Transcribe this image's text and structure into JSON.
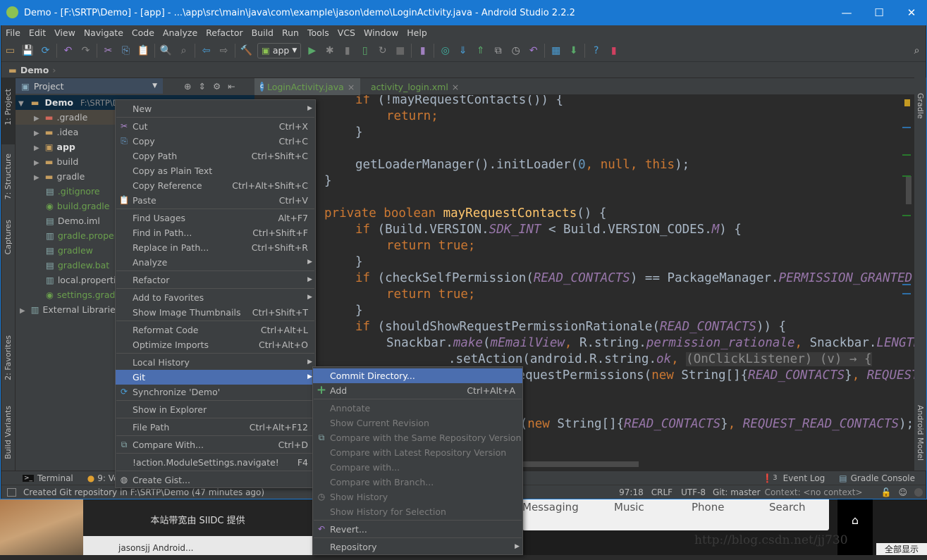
{
  "window": {
    "title": "Demo - [F:\\SRTP\\Demo] - [app] - ...\\app\\src\\main\\java\\com\\example\\jason\\demo\\LoginActivity.java - Android Studio 2.2.2",
    "controls": [
      "minimize",
      "maximize",
      "close"
    ]
  },
  "menubar": [
    "File",
    "Edit",
    "View",
    "Navigate",
    "Code",
    "Analyze",
    "Refactor",
    "Build",
    "Run",
    "Tools",
    "VCS",
    "Window",
    "Help"
  ],
  "toolbar": {
    "icons_left": [
      "open-folder-icon",
      "save-icon",
      "sync-icon",
      "|",
      "undo-icon",
      "redo-icon",
      "|",
      "cut-icon",
      "copy-icon",
      "paste-icon",
      "|",
      "find-icon",
      "replace-icon",
      "|",
      "back-icon",
      "forward-icon",
      "|",
      "make-project-icon"
    ],
    "run_config": "app",
    "icons_right": [
      "run-icon",
      "debug-icon",
      "profile-icon",
      "apply-changes-icon",
      "rerun-icon",
      "stop-icon",
      "|",
      "avd-manager-icon",
      "|",
      "sync-gradle-icon",
      "vcs-update-icon",
      "vcs-commit-icon",
      "vcs-compare-icon",
      "vcs-history-icon",
      "vcs-revert-icon",
      "|",
      "project-structure-icon",
      "sdk-manager-icon",
      "|",
      "help-icon",
      "device-monitor-icon"
    ],
    "search_icon": "search-icon"
  },
  "breadcrumb": "Demo",
  "left_strip": [
    "1: Project",
    "7: Structure",
    "Captures",
    "2: Favorites",
    "Build Variants"
  ],
  "right_strip": [
    "Gradle",
    "Android Model"
  ],
  "project_panel": {
    "view": "Project",
    "root": {
      "name": "Demo",
      "path": "F:\\SRTP\\Demo"
    },
    "items": [
      {
        "name": ".gradle",
        "type": "folder",
        "color": "#d0675a",
        "text_color": "#bbbbbb"
      },
      {
        "name": ".idea",
        "type": "folder",
        "color": "#c59d5f",
        "text_color": "#bbbbbb"
      },
      {
        "name": "app",
        "type": "module",
        "color": "#c59d5f",
        "text_color": "#dddddd"
      },
      {
        "name": "build",
        "type": "folder",
        "color": "#c59d5f",
        "text_color": "#bbbbbb"
      },
      {
        "name": "gradle",
        "type": "folder",
        "color": "#c59d5f",
        "text_color": "#bbbbbb"
      },
      {
        "name": ".gitignore",
        "type": "file",
        "text_color": "#6a9f4d"
      },
      {
        "name": "build.gradle",
        "type": "gradle",
        "text_color": "#6a9f4d"
      },
      {
        "name": "Demo.iml",
        "type": "file",
        "text_color": "#bbbbbb"
      },
      {
        "name": "gradle.properties",
        "type": "props",
        "text_color": "#6a9f4d"
      },
      {
        "name": "gradlew",
        "type": "file",
        "text_color": "#6a9f4d"
      },
      {
        "name": "gradlew.bat",
        "type": "file",
        "text_color": "#6a9f4d"
      },
      {
        "name": "local.properties",
        "type": "props",
        "text_color": "#bbbbbb"
      },
      {
        "name": "settings.gradle",
        "type": "gradle",
        "text_color": "#6a9f4d"
      },
      {
        "name": "External Libraries",
        "type": "libs",
        "text_color": "#bbbbbb"
      }
    ]
  },
  "tabs": [
    {
      "label": "LoginActivity.java",
      "active": true
    },
    {
      "label": "activity_login.xml",
      "active": false
    }
  ],
  "code": [
    {
      "i": 1,
      "t": [
        [
          "if",
          "kw"
        ],
        [
          " (!mayRequestContacts()) {",
          ""
        ]
      ]
    },
    {
      "i": 2,
      "t": [
        [
          "return;",
          "kw"
        ]
      ]
    },
    {
      "i": 1,
      "t": [
        [
          "}",
          ""
        ]
      ]
    },
    {
      "i": 0,
      "t": []
    },
    {
      "i": 1,
      "t": [
        [
          "getLoaderManager().initLoader(",
          ""
        ],
        [
          "0",
          "nm"
        ],
        [
          ", ",
          "kw"
        ],
        [
          "null",
          "kw"
        ],
        [
          ", ",
          "kw"
        ],
        [
          "this",
          "kw"
        ],
        [
          ");",
          ""
        ]
      ]
    },
    {
      "i": 0,
      "t": [
        [
          "}",
          ""
        ]
      ]
    },
    {
      "i": 0,
      "t": []
    },
    {
      "i": 0,
      "t": [
        [
          "private boolean ",
          "kw"
        ],
        [
          "mayRequestContacts",
          "fn"
        ],
        [
          "() {",
          ""
        ]
      ]
    },
    {
      "i": 1,
      "t": [
        [
          "if",
          "kw"
        ],
        [
          " (Build.VERSION.",
          ""
        ],
        [
          "SDK_INT",
          "cn"
        ],
        [
          " < Build.VERSION_CODES.",
          ""
        ],
        [
          "M",
          "cn"
        ],
        [
          ") {",
          ""
        ]
      ]
    },
    {
      "i": 2,
      "t": [
        [
          "return true;",
          "kw"
        ]
      ]
    },
    {
      "i": 1,
      "t": [
        [
          "}",
          ""
        ]
      ]
    },
    {
      "i": 1,
      "t": [
        [
          "if",
          "kw"
        ],
        [
          " (checkSelfPermission(",
          ""
        ],
        [
          "READ_CONTACTS",
          "cn"
        ],
        [
          ") == PackageManager.",
          ""
        ],
        [
          "PERMISSION_GRANTED",
          "cn"
        ],
        [
          ") {",
          ""
        ]
      ]
    },
    {
      "i": 2,
      "t": [
        [
          "return true;",
          "kw"
        ]
      ]
    },
    {
      "i": 1,
      "t": [
        [
          "}",
          ""
        ]
      ]
    },
    {
      "i": 1,
      "t": [
        [
          "if",
          "kw"
        ],
        [
          " (shouldShowRequestPermissionRationale(",
          ""
        ],
        [
          "READ_CONTACTS",
          "cn"
        ],
        [
          ")) {",
          ""
        ]
      ]
    },
    {
      "i": 2,
      "t": [
        [
          "Snackbar.",
          ""
        ],
        [
          "make",
          "cn"
        ],
        [
          "(",
          ""
        ],
        [
          "mEmailView",
          "cn"
        ],
        [
          ", ",
          "kw"
        ],
        [
          "R.string.",
          ""
        ],
        [
          "permission_rationale",
          "cn"
        ],
        [
          ", ",
          "kw"
        ],
        [
          "Snackbar.",
          ""
        ],
        [
          "LENGTH_INDEFINITE",
          "cn"
        ],
        [
          ")",
          ""
        ]
      ]
    },
    {
      "i": 4,
      "t": [
        [
          ".setAction(android.R.string.",
          ""
        ],
        [
          "ok",
          "cn"
        ],
        [
          ", ",
          "kw"
        ],
        [
          "(OnClickListener) (v) → {",
          "fold"
        ]
      ]
    },
    {
      "i": 6,
      "t": [
        [
          "requestPermissions(",
          ""
        ],
        [
          "new ",
          "kw"
        ],
        [
          "String[]{",
          ""
        ],
        [
          "READ_CONTACTS",
          "cn"
        ],
        [
          "}",
          ""
        ],
        [
          ", ",
          "kw"
        ],
        [
          "REQUEST_READ_CONTACTS",
          "cn"
        ],
        [
          ");",
          ""
        ]
      ]
    },
    {
      "i": 4,
      "t": [
        [
          "});",
          ""
        ]
      ]
    },
    {
      "i": 1,
      "t": [
        [
          "} ",
          ""
        ],
        [
          "else",
          "kw"
        ],
        [
          " {",
          ""
        ]
      ]
    },
    {
      "i": 2,
      "t": [
        [
          "requestPermissions(",
          ""
        ],
        [
          "new ",
          "kw"
        ],
        [
          "String[]{",
          ""
        ],
        [
          "READ_CONTACTS",
          "cn"
        ],
        [
          "}",
          ""
        ],
        [
          ", ",
          "kw"
        ],
        [
          "REQUEST_READ_CONTACTS",
          "cn"
        ],
        [
          ");",
          ""
        ]
      ]
    },
    {
      "i": 1,
      "t": [
        [
          "}",
          ""
        ]
      ]
    }
  ],
  "context_menu": [
    {
      "label": "New",
      "sub": true
    },
    "-",
    {
      "label": "Cut",
      "sc": "Ctrl+X",
      "icon": "cut-icon"
    },
    {
      "label": "Copy",
      "sc": "Ctrl+C",
      "icon": "copy-icon"
    },
    {
      "label": "Copy Path",
      "sc": "Ctrl+Shift+C"
    },
    {
      "label": "Copy as Plain Text"
    },
    {
      "label": "Copy Reference",
      "sc": "Ctrl+Alt+Shift+C"
    },
    {
      "label": "Paste",
      "sc": "Ctrl+V",
      "icon": "paste-icon"
    },
    "-",
    {
      "label": "Find Usages",
      "sc": "Alt+F7"
    },
    {
      "label": "Find in Path...",
      "sc": "Ctrl+Shift+F"
    },
    {
      "label": "Replace in Path...",
      "sc": "Ctrl+Shift+R"
    },
    {
      "label": "Analyze",
      "sub": true
    },
    "-",
    {
      "label": "Refactor",
      "sub": true
    },
    "-",
    {
      "label": "Add to Favorites",
      "sub": true
    },
    {
      "label": "Show Image Thumbnails",
      "sc": "Ctrl+Shift+T"
    },
    "-",
    {
      "label": "Reformat Code",
      "sc": "Ctrl+Alt+L"
    },
    {
      "label": "Optimize Imports",
      "sc": "Ctrl+Alt+O"
    },
    "-",
    {
      "label": "Local History",
      "sub": true
    },
    {
      "label": "Git",
      "sub": true,
      "selected": true
    },
    {
      "label": "Synchronize 'Demo'",
      "icon": "sync-icon"
    },
    "-",
    {
      "label": "Show in Explorer"
    },
    "-",
    {
      "label": "File Path",
      "sc": "Ctrl+Alt+F12"
    },
    "-",
    {
      "label": "Compare With...",
      "sc": "Ctrl+D",
      "icon": "compare-icon"
    },
    "-",
    {
      "label": "!action.ModuleSettings.navigate!",
      "sc": "F4"
    },
    "-",
    {
      "label": "Create Gist...",
      "icon": "github-icon"
    }
  ],
  "git_submenu": [
    {
      "label": "Commit Directory...",
      "selected": true
    },
    {
      "label": "Add",
      "sc": "Ctrl+Alt+A",
      "icon": "plus-icon"
    },
    "-",
    {
      "label": "Annotate",
      "disabled": true
    },
    {
      "label": "Show Current Revision",
      "disabled": true
    },
    {
      "label": "Compare with the Same Repository Version",
      "disabled": true,
      "icon": "compare-icon"
    },
    {
      "label": "Compare with Latest Repository Version",
      "disabled": true
    },
    {
      "label": "Compare with...",
      "disabled": true
    },
    {
      "label": "Compare with Branch...",
      "disabled": true
    },
    {
      "label": "Show History",
      "disabled": true,
      "icon": "history-icon"
    },
    {
      "label": "Show History for Selection",
      "disabled": true
    },
    "-",
    {
      "label": "Revert...",
      "icon": "revert-icon"
    },
    "-",
    {
      "label": "Repository",
      "sub": true
    }
  ],
  "bottom_tools": {
    "terminal": "Terminal",
    "version_control": "9: Version Control",
    "event_log_count": "3",
    "event_log": "Event Log",
    "gradle_console": "Gradle Console"
  },
  "status": {
    "message": "Created Git repository in F:\\SRTP\\Demo (47 minutes ago)",
    "position": "97:18",
    "line_sep": "CRLF",
    "encoding": "UTF-8",
    "vcs": "Git: master",
    "context": "Context: <no context>"
  },
  "background": {
    "banner": "本站带宽由 SIIDC 提供",
    "launcher": [
      "Messaging",
      "Music",
      "Phone",
      "Search"
    ],
    "watermark": "http://blog.csdn.net/jj730",
    "taskbar_item": "jasonsjj Android...",
    "show_all": "全部显示"
  },
  "colors": {
    "accent": "#4b6eaf",
    "titlebar": "#1a78d2",
    "panel": "#3c3f41",
    "editor": "#2b2b2b"
  }
}
